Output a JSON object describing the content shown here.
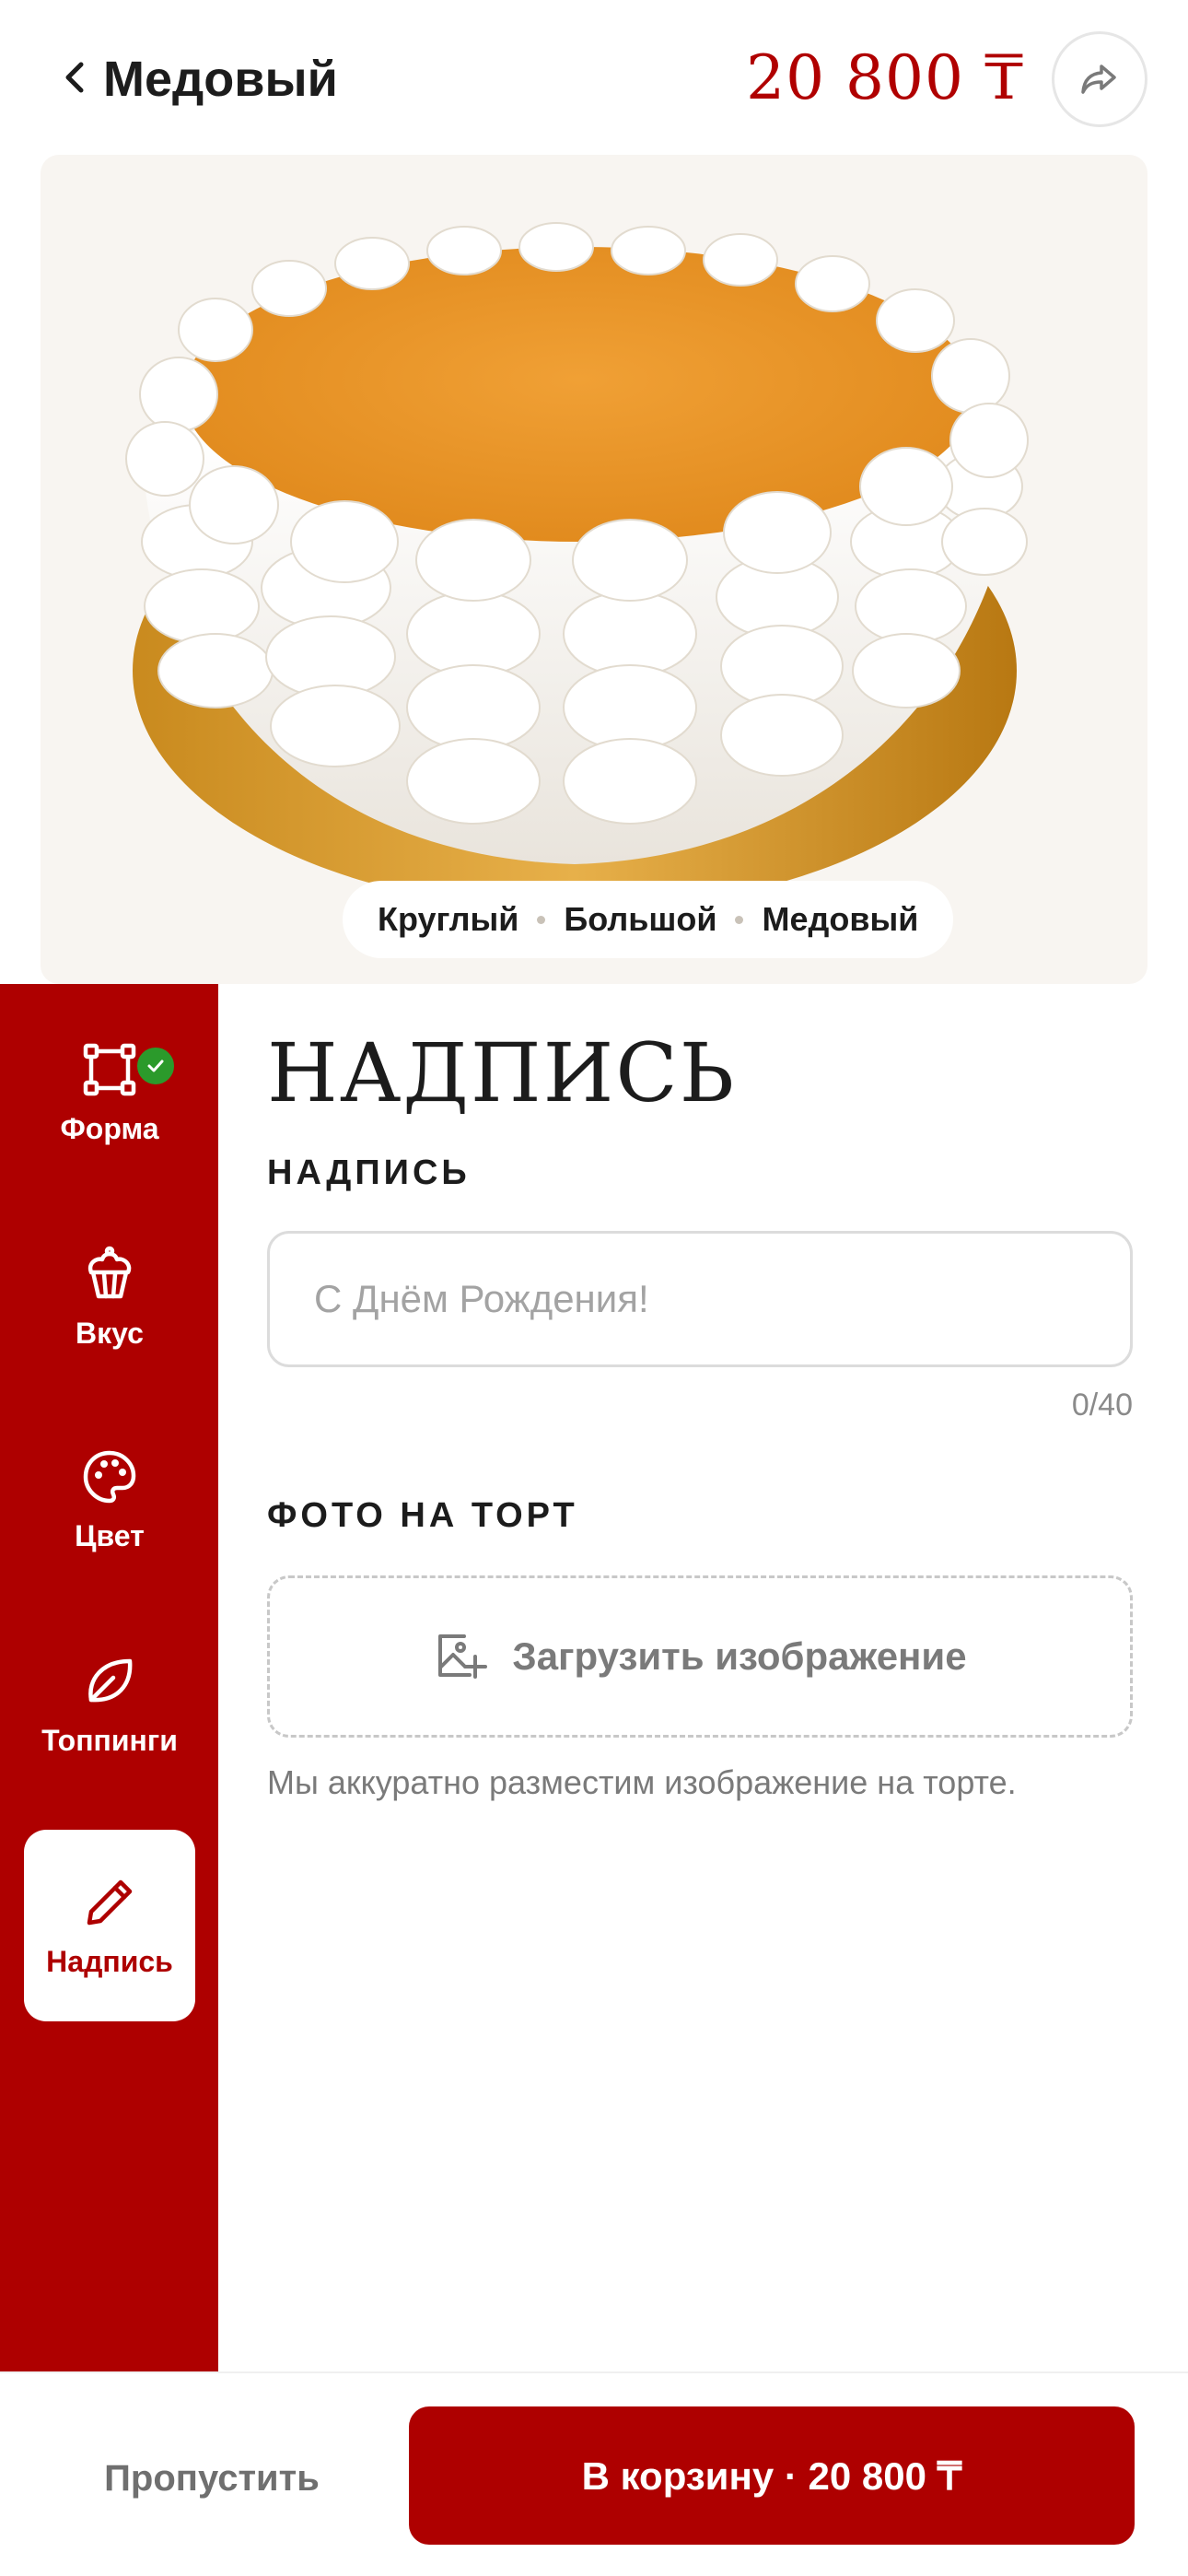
{
  "header": {
    "title": "Медовый",
    "price": "20 800 ₸"
  },
  "hero": {
    "chips": [
      "Круглый",
      "Большой",
      "Медовый"
    ]
  },
  "sidebar": {
    "items": [
      {
        "label": "Форма",
        "icon": "shape-frame-icon",
        "completed": true,
        "active": false
      },
      {
        "label": "Вкус",
        "icon": "cupcake-icon",
        "completed": false,
        "active": false
      },
      {
        "label": "Цвет",
        "icon": "palette-icon",
        "completed": false,
        "active": false
      },
      {
        "label": "Топпинги",
        "icon": "leaf-icon",
        "completed": false,
        "active": false
      },
      {
        "label": "Надпись",
        "icon": "pencil-icon",
        "completed": false,
        "active": true
      }
    ]
  },
  "main": {
    "section_title": "НАДПИСЬ",
    "inscription": {
      "label": "НАДПИСЬ",
      "placeholder": "С Днём Рождения!",
      "value": "",
      "counter": "0/40"
    },
    "photo": {
      "label": "ФОТО НА ТОРТ",
      "upload_label": "Загрузить изображение",
      "hint": "Мы аккуратно разместим изображение на торте."
    }
  },
  "footer": {
    "skip_label": "Пропустить",
    "cart_label": "В корзину · 20 800 ₸"
  },
  "colors": {
    "accent": "#ae0000",
    "price": "#b00000",
    "success": "#2b9a2b",
    "hero_bg": "#f8f5f1"
  }
}
